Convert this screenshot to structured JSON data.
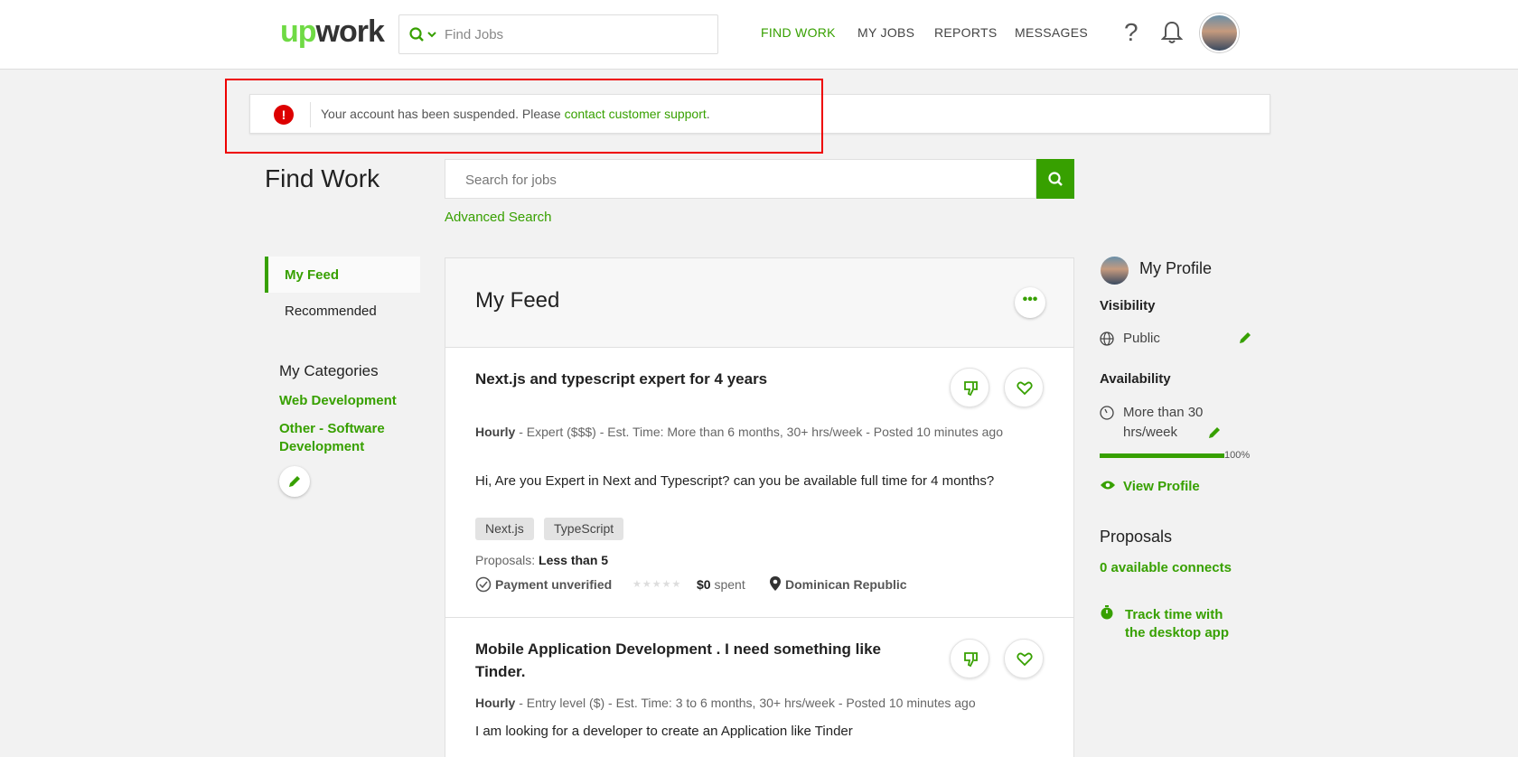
{
  "header": {
    "logo_up": "up",
    "logo_work": "work",
    "search_placeholder": "Find Jobs",
    "nav": [
      "FIND WORK",
      "MY JOBS",
      "REPORTS",
      "MESSAGES"
    ],
    "help_symbol": "?"
  },
  "alert": {
    "symbol": "!",
    "message": "Your account has been suspended. Please ",
    "link": "contact customer support",
    "end": "."
  },
  "find_work": {
    "title": "Find Work",
    "search_placeholder": "Search for jobs",
    "advanced": "Advanced Search"
  },
  "sidebar": {
    "items": [
      "My Feed",
      "Recommended"
    ],
    "categories_title": "My Categories",
    "categories": [
      "Web Development",
      "Other - Software Development"
    ]
  },
  "feed": {
    "title": "My Feed",
    "more_symbol": "•••",
    "jobs": [
      {
        "title": "Next.js and typescript expert for 4 years",
        "type": "Hourly",
        "meta": " - Expert ($$$) - Est. Time: More than 6 months, 30+ hrs/week - Posted 10 minutes ago",
        "description": "Hi, Are you Expert in Next and Typescript? can you be available full time for 4 months?",
        "tags": [
          "Next.js",
          "TypeScript"
        ],
        "proposals_label": "Proposals: ",
        "proposals_value": "Less than 5",
        "payment": "Payment unverified",
        "stars": "★★★★★",
        "spent_amount": "$0",
        "spent_label": " spent",
        "location": "Dominican Republic"
      },
      {
        "title": "Mobile Application Development . I need something like Tinder.",
        "type": "Hourly",
        "meta": " - Entry level ($) - Est. Time: 3 to 6 months, 30+ hrs/week - Posted 10 minutes ago",
        "description": "I am looking for a developer to create an Application like Tinder"
      }
    ]
  },
  "profile": {
    "title": "My Profile",
    "visibility_label": "Visibility",
    "visibility_value": "Public",
    "availability_label": "Availability",
    "availability_value_1": "More than 30",
    "availability_value_2": "hrs/week",
    "progress_percent": 100,
    "progress_label": "100%",
    "view_profile": "View Profile",
    "proposals_title": "Proposals",
    "connects": "0 available connects",
    "track_1": "Track time with",
    "track_2": "the desktop app"
  },
  "colors": {
    "accent": "#37a000",
    "alert_red": "#dd0000",
    "logo_green": "#6fda44"
  }
}
